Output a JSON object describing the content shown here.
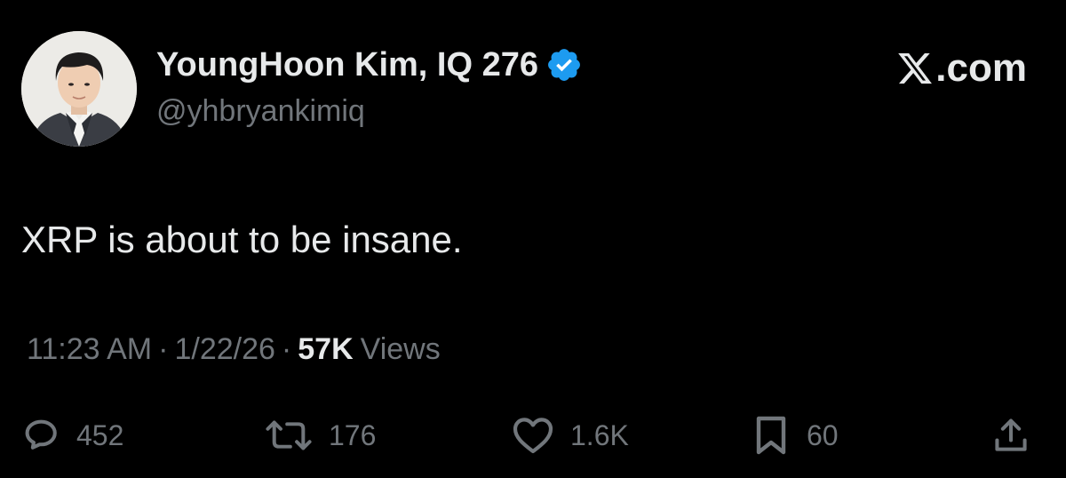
{
  "author": {
    "display_name": "YoungHoon Kim, IQ 276",
    "handle": "@yhbryankimiq",
    "verified": true,
    "verified_color": "#1d9bf0"
  },
  "site": {
    "label": ".com",
    "icon": "x-logo-icon"
  },
  "tweet": {
    "text": "XRP is about to be insane."
  },
  "meta": {
    "time": "11:23 AM",
    "separator": "·",
    "date": "1/22/26",
    "views_count": "57K",
    "views_label": "Views"
  },
  "actions": {
    "replies": {
      "icon": "reply-icon",
      "count": "452"
    },
    "reposts": {
      "icon": "repost-icon",
      "count": "176"
    },
    "likes": {
      "icon": "heart-icon",
      "count": "1.6K"
    },
    "bookmarks": {
      "icon": "bookmark-icon",
      "count": "60"
    },
    "share": {
      "icon": "share-icon"
    }
  },
  "colors": {
    "background": "#000000",
    "primary_text": "#e7e9ea",
    "secondary_text": "#71767b"
  }
}
